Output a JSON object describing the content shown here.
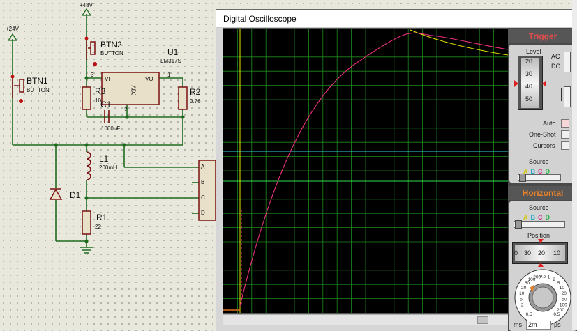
{
  "schematic": {
    "supply_24": "+24V",
    "supply_48": "+48V",
    "btn1_name": "BTN1",
    "btn1_type": "BUTTON",
    "btn2_name": "BTN2",
    "btn2_type": "BUTTON",
    "u1_name": "U1",
    "u1_part": "LM317S",
    "u1_pin_vi": "VI",
    "u1_pin_vo": "VO",
    "u1_pin_adj": "ADJ",
    "u1_pin3": "3",
    "u1_pin1": "1",
    "u1_pin2": "2",
    "r3_name": "R3",
    "r3_value": "10",
    "r2_name": "R2",
    "r2_value": "0.76",
    "c1_name": "C1",
    "c1_value": "1000uF",
    "l1_name": "L1",
    "l1_value": "200mH",
    "d1_name": "D1",
    "r1_name": "R1",
    "r1_value": "22",
    "probe_a": "A",
    "probe_b": "B",
    "probe_c": "C",
    "probe_d": "D"
  },
  "oscilloscope": {
    "title": "Digital Oscilloscope",
    "trigger": {
      "header": "Trigger",
      "level_label": "Level",
      "level_ticks": [
        "20",
        "30",
        "40",
        "50"
      ],
      "ac_label": "AC",
      "dc_label": "DC",
      "auto_label": "Auto",
      "oneshot_label": "One-Shot",
      "cursors_label": "Cursors",
      "source_label": "Source",
      "source_channels": [
        "A",
        "B",
        "C",
        "D"
      ]
    },
    "horizontal": {
      "header": "Horizontal",
      "source_label": "Source",
      "source_channels": [
        "A",
        "B",
        "C",
        "D"
      ],
      "position_label": "Position",
      "position_ticks": [
        "0",
        "30",
        "20",
        "10"
      ],
      "timebase_ticks": [
        "0.5",
        "1",
        "2",
        "5",
        "10",
        "20",
        "50",
        "100",
        "200",
        "0.5",
        "1",
        "2",
        "5",
        "10",
        "20",
        "50",
        "100",
        "200",
        "0.5"
      ],
      "unit_left": "ms",
      "timebase_value": "2m",
      "unit_right": "µs"
    },
    "trace_colors": {
      "A": "#e8e800",
      "B": "#2fd0e0",
      "C": "#f03080",
      "D": "#30e050",
      "grid": "#1f8a1f",
      "background": "#000000"
    }
  }
}
